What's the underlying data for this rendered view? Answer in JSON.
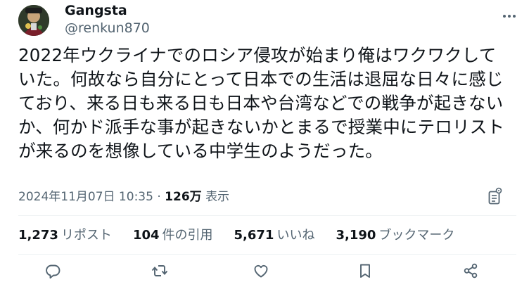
{
  "user": {
    "name": "Gangsta",
    "handle": "@renkun870",
    "avatar_icon": "avatar-illustration"
  },
  "tweet": {
    "lines": [
      "2022年ウクライナでのロシア侵攻が始まり俺はワクワクして",
      "いた。何故なら自分にとって日本での生活は退屈な日々に感じ",
      "ており、来る日も来る日も日本や台湾などでの戦争が起きない",
      "か、何かド派手な事が起きないかとまるで授業中にテロリスト",
      "が来るのを想像している中学生のようだった。"
    ]
  },
  "meta": {
    "timestamp": "2024年11月07日 10:35",
    "separator": "·",
    "views_count": "126万",
    "views_label": "表示"
  },
  "stats": [
    {
      "count": "1,273",
      "label": "リポスト"
    },
    {
      "count": "104",
      "label": "件の引用"
    },
    {
      "count": "5,671",
      "label": "いいね"
    },
    {
      "count": "3,190",
      "label": "ブックマーク"
    }
  ],
  "icons": {
    "more": "more-horizontal-icon",
    "analytics": "analytics-icon",
    "reply": "reply-icon",
    "retweet": "retweet-icon",
    "like": "like-icon",
    "bookmark": "bookmark-icon",
    "share": "share-icon"
  },
  "colors": {
    "text": "#0f1419",
    "secondary": "#536471",
    "divider": "#eff3f4"
  }
}
